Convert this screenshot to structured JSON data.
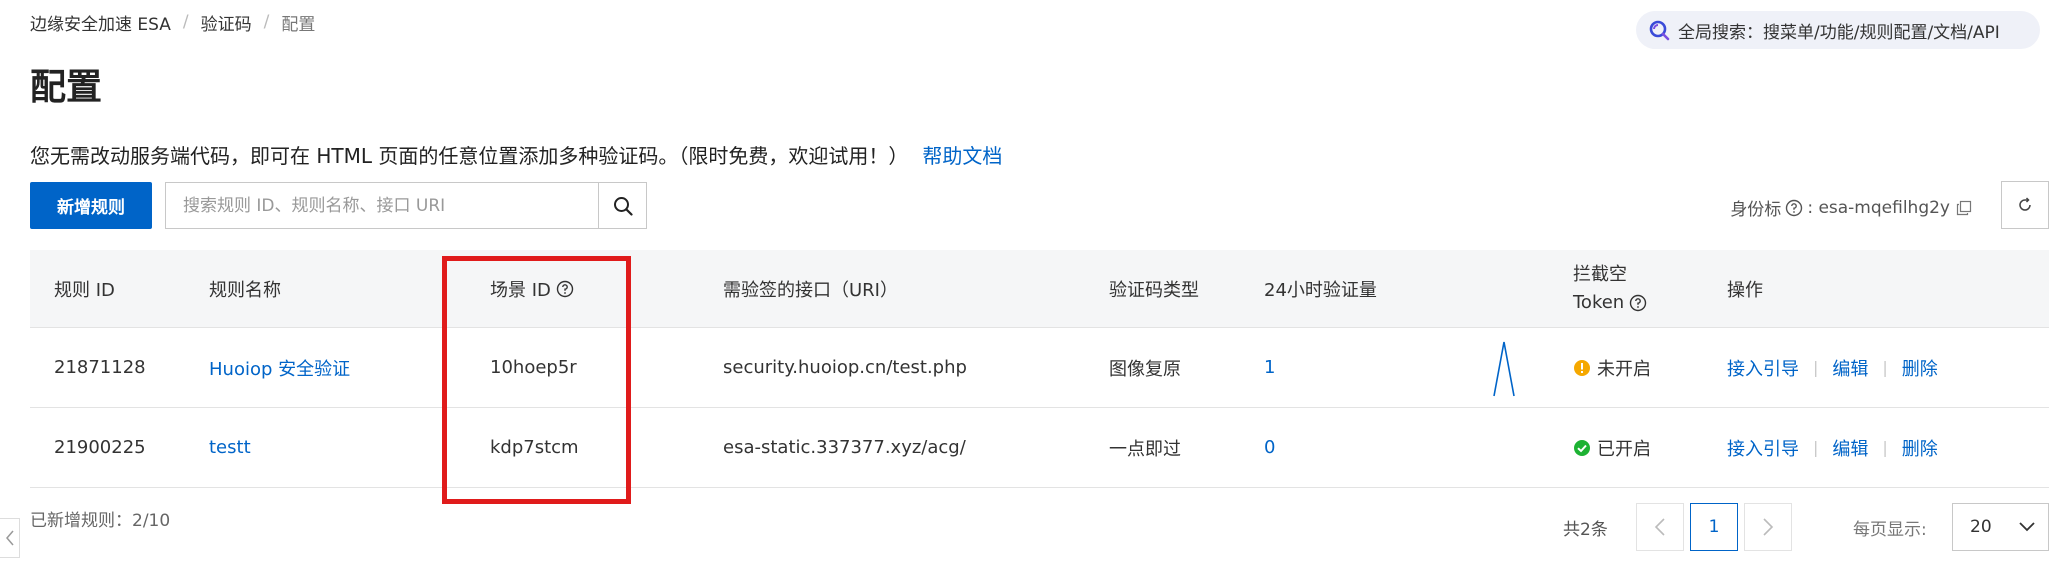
{
  "breadcrumb": {
    "items": [
      "边缘安全加速 ESA",
      "验证码",
      "配置"
    ],
    "separator": "/"
  },
  "global_search": {
    "label": "全局搜索：搜菜单/功能/规则配置/文档/API"
  },
  "page": {
    "title": "配置"
  },
  "intro": {
    "text": "您无需改动服务端代码，即可在 HTML 页面的任意位置添加多种验证码。（限时免费，欢迎试用！）",
    "help_link": "帮助文档"
  },
  "toolbar": {
    "add_button": "新增规则",
    "search_placeholder": "搜索规则 ID、规则名称、接口 URI",
    "identity_label": "身份标",
    "identity_value": ": esa-mqefilhg2y"
  },
  "table": {
    "headers": {
      "rule_id": "规则 ID",
      "rule_name": "规则名称",
      "scene_id": "场景 ID",
      "uri": "需验签的接口（URI）",
      "captcha_type": "验证码类型",
      "volume": "24小时验证量",
      "token_line1": "拦截空",
      "token_line2": "Token",
      "actions": "操作"
    },
    "rows": [
      {
        "rule_id": "21871128",
        "rule_name": "Huoiop 安全验证",
        "scene_id": "10hoep5r",
        "uri": "security.huoiop.cn/test.php",
        "captcha_type": "图像复原",
        "volume": "1",
        "token_status": "未开启",
        "token_state": "off"
      },
      {
        "rule_id": "21900225",
        "rule_name": "testt",
        "scene_id": "kdp7stcm",
        "uri": "esa-static.337377.xyz/acg/",
        "captcha_type": "一点即过",
        "volume": "0",
        "token_status": "已开启",
        "token_state": "on"
      }
    ],
    "action_labels": [
      "接入引导",
      "编辑",
      "删除"
    ]
  },
  "footer": {
    "rule_count": "已新增规则：2/10",
    "total": "共2条",
    "current_page": "1",
    "per_page_label": "每页显示:",
    "per_page_value": "20"
  },
  "colors": {
    "primary": "#0064c8",
    "highlight": "#e01b1b",
    "status_off": "#f5a800",
    "status_on": "#1db233"
  }
}
